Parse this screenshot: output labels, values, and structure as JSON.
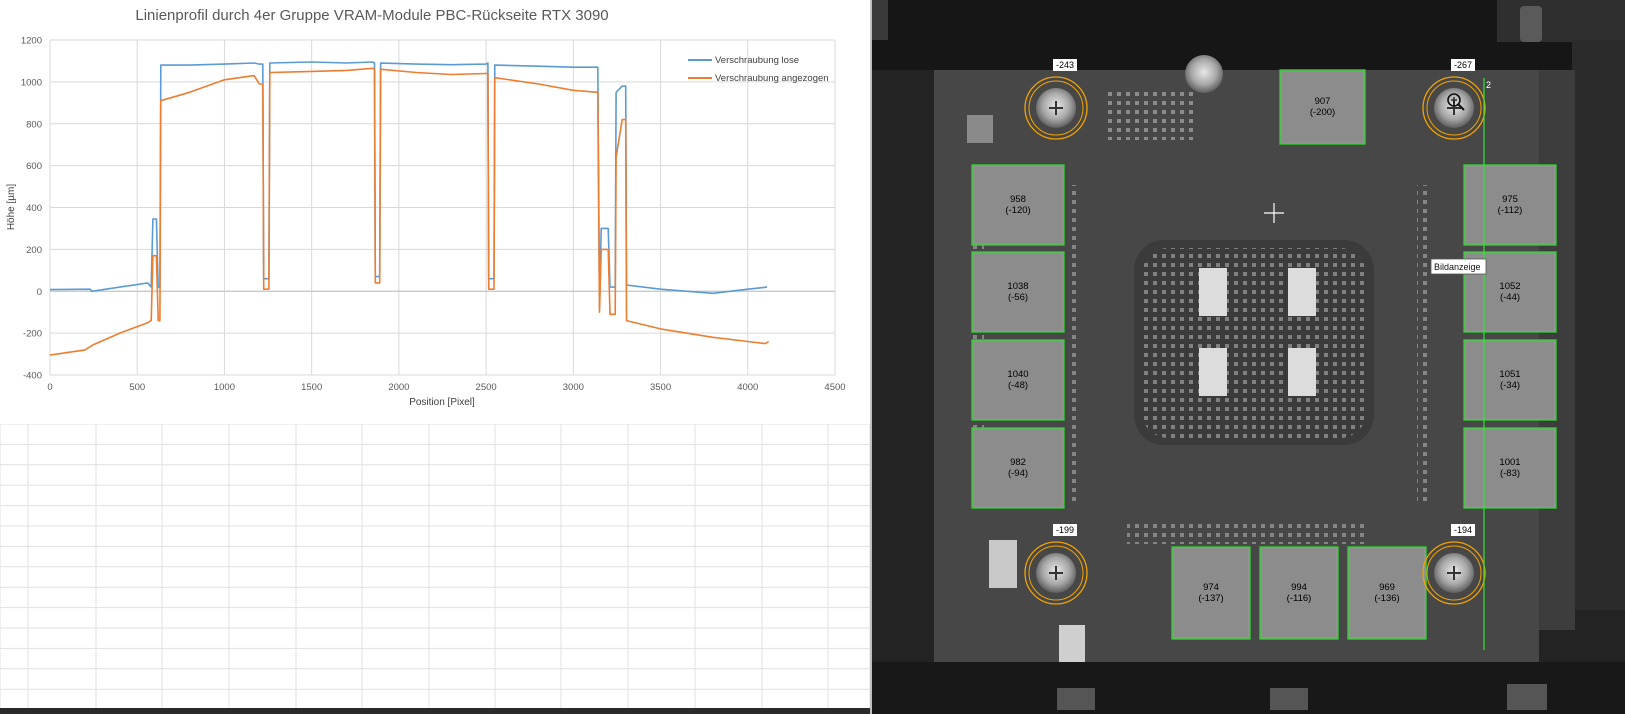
{
  "chart_data": {
    "type": "line",
    "title": "Linienprofil durch 4er Gruppe VRAM-Module PBC-Rückseite RTX 3090",
    "xlabel": "Position [Pixel]",
    "ylabel": "Höhe [µm]",
    "xlim": [
      0,
      4500
    ],
    "ylim": [
      -400,
      1200
    ],
    "xticks": [
      0,
      500,
      1000,
      1500,
      2000,
      2500,
      3000,
      3500,
      4000,
      4500
    ],
    "yticks": [
      -400,
      -200,
      0,
      200,
      400,
      600,
      800,
      1000,
      1200
    ],
    "grid": true,
    "legend_position": "top-right",
    "series": [
      {
        "name": "Verschraubung lose",
        "color": "#5b9bd5",
        "points": [
          [
            0,
            8
          ],
          [
            230,
            10
          ],
          [
            240,
            0
          ],
          [
            560,
            40
          ],
          [
            580,
            20
          ],
          [
            590,
            345
          ],
          [
            610,
            345
          ],
          [
            620,
            20
          ],
          [
            630,
            20
          ],
          [
            635,
            1080
          ],
          [
            800,
            1080
          ],
          [
            1000,
            1085
          ],
          [
            1170,
            1090
          ],
          [
            1200,
            1085
          ],
          [
            1220,
            1085
          ],
          [
            1225,
            60
          ],
          [
            1255,
            60
          ],
          [
            1260,
            1090
          ],
          [
            1500,
            1095
          ],
          [
            1700,
            1090
          ],
          [
            1850,
            1095
          ],
          [
            1860,
            1090
          ],
          [
            1865,
            70
          ],
          [
            1890,
            70
          ],
          [
            1895,
            1090
          ],
          [
            2100,
            1085
          ],
          [
            2300,
            1082
          ],
          [
            2500,
            1085
          ],
          [
            2510,
            1090
          ],
          [
            2515,
            60
          ],
          [
            2545,
            60
          ],
          [
            2550,
            1080
          ],
          [
            2800,
            1075
          ],
          [
            3000,
            1070
          ],
          [
            3140,
            1070
          ],
          [
            3150,
            -80
          ],
          [
            3160,
            300
          ],
          [
            3200,
            300
          ],
          [
            3210,
            20
          ],
          [
            3240,
            20
          ],
          [
            3245,
            950
          ],
          [
            3280,
            980
          ],
          [
            3290,
            980
          ],
          [
            3300,
            980
          ],
          [
            3305,
            30
          ],
          [
            3500,
            10
          ],
          [
            3800,
            -10
          ],
          [
            4000,
            10
          ],
          [
            4110,
            20
          ]
        ]
      },
      {
        "name": "Verschraubung angezogen",
        "color": "#ed7d31",
        "points": [
          [
            0,
            -305
          ],
          [
            200,
            -280
          ],
          [
            250,
            -255
          ],
          [
            400,
            -200
          ],
          [
            560,
            -150
          ],
          [
            580,
            -140
          ],
          [
            590,
            170
          ],
          [
            610,
            170
          ],
          [
            620,
            -140
          ],
          [
            630,
            -140
          ],
          [
            635,
            910
          ],
          [
            800,
            950
          ],
          [
            1000,
            1010
          ],
          [
            1170,
            1030
          ],
          [
            1200,
            990
          ],
          [
            1220,
            990
          ],
          [
            1225,
            10
          ],
          [
            1255,
            10
          ],
          [
            1260,
            1045
          ],
          [
            1500,
            1050
          ],
          [
            1700,
            1055
          ],
          [
            1850,
            1065
          ],
          [
            1860,
            1060
          ],
          [
            1865,
            40
          ],
          [
            1890,
            40
          ],
          [
            1895,
            1060
          ],
          [
            2100,
            1045
          ],
          [
            2300,
            1035
          ],
          [
            2500,
            1040
          ],
          [
            2510,
            1040
          ],
          [
            2515,
            10
          ],
          [
            2545,
            10
          ],
          [
            2550,
            1020
          ],
          [
            2800,
            990
          ],
          [
            3000,
            960
          ],
          [
            3140,
            950
          ],
          [
            3150,
            -100
          ],
          [
            3160,
            200
          ],
          [
            3200,
            200
          ],
          [
            3210,
            -110
          ],
          [
            3240,
            -110
          ],
          [
            3245,
            640
          ],
          [
            3280,
            820
          ],
          [
            3300,
            820
          ],
          [
            3305,
            -140
          ],
          [
            3500,
            -180
          ],
          [
            3800,
            -220
          ],
          [
            4000,
            -240
          ],
          [
            4100,
            -250
          ],
          [
            4120,
            -240
          ]
        ]
      }
    ]
  },
  "scan": {
    "modules": [
      {
        "value": "907",
        "offset": "(-200)"
      },
      {
        "value": "958",
        "offset": "(-120)"
      },
      {
        "value": "975",
        "offset": "(-112)"
      },
      {
        "value": "1038",
        "offset": "(-56)"
      },
      {
        "value": "1052",
        "offset": "(-44)"
      },
      {
        "value": "1040",
        "offset": "(-48)"
      },
      {
        "value": "1051",
        "offset": "(-34)"
      },
      {
        "value": "982",
        "offset": "(-94)"
      },
      {
        "value": "1001",
        "offset": "(-83)"
      },
      {
        "value": "974",
        "offset": "(-137)"
      },
      {
        "value": "994",
        "offset": "(-116)"
      },
      {
        "value": "969",
        "offset": "(-136)"
      }
    ],
    "screw_labels": [
      "-243",
      "-267",
      "-199",
      "-194"
    ],
    "profile_marker": "2",
    "tooltip": "Bildanzeige",
    "cursor_icon": "magnifier-icon"
  }
}
